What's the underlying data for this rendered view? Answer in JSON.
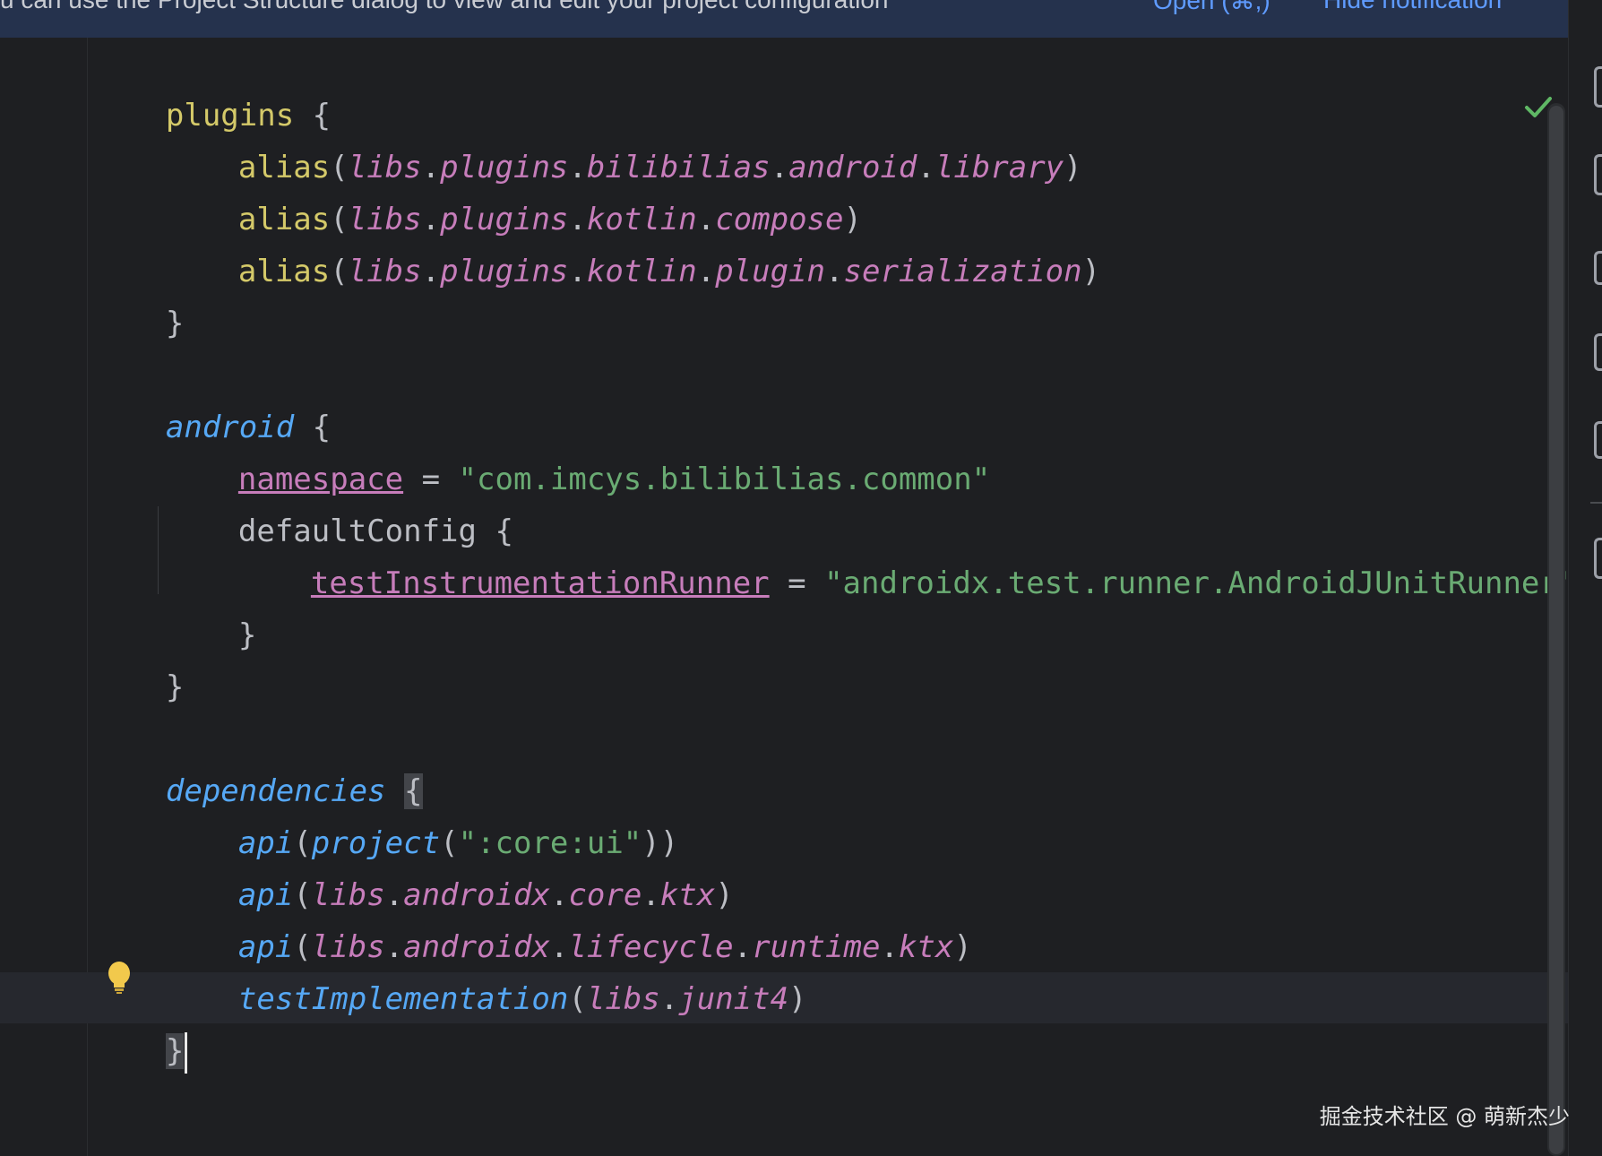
{
  "banner": {
    "message": "u can use the Project Structure dialog to view and edit your project configuration",
    "open_label": "Open (⌘;)",
    "hide_label": "Hide notification"
  },
  "code": {
    "l1": {
      "kw": "plugins",
      "brace": " {"
    },
    "l2": {
      "fn": "alias",
      "open": "(",
      "path": [
        "libs",
        "plugins",
        "bilibilias",
        "android",
        "library"
      ],
      "close": ")"
    },
    "l3": {
      "fn": "alias",
      "open": "(",
      "path": [
        "libs",
        "plugins",
        "kotlin",
        "compose"
      ],
      "close": ")"
    },
    "l4": {
      "fn": "alias",
      "open": "(",
      "path": [
        "libs",
        "plugins",
        "kotlin",
        "plugin",
        "serialization"
      ],
      "close": ")"
    },
    "l5": "}",
    "l7": {
      "kw": "android",
      "brace": " {"
    },
    "l8": {
      "prop": "namespace",
      "eq": " = ",
      "str": "\"com.imcys.bilibilias.common\""
    },
    "l9": {
      "kw": "defaultConfig",
      "brace": " {"
    },
    "l10": {
      "prop": "testInstrumentationRunner",
      "eq": " = ",
      "str": "\"androidx.test.runner.AndroidJUnitRunner\""
    },
    "l11": "}",
    "l12": "}",
    "l14": {
      "kw": "dependencies",
      "space": " ",
      "brace": "{"
    },
    "l15": {
      "fn": "api",
      "open": "(",
      "fn2": "project",
      "open2": "(",
      "str": "\":core:ui\"",
      "close": "))"
    },
    "l16": {
      "fn": "api",
      "open": "(",
      "path": [
        "libs",
        "androidx",
        "core",
        "ktx"
      ],
      "close": ")"
    },
    "l17": {
      "fn": "api",
      "open": "(",
      "path": [
        "libs",
        "androidx",
        "lifecycle",
        "runtime",
        "ktx"
      ],
      "close": ")"
    },
    "l18": {
      "fn": "testImplementation",
      "open": "(",
      "path": [
        "libs",
        "junit4"
      ],
      "close": ")"
    },
    "l19": "}"
  },
  "icons": {
    "inspection": "check-icon",
    "intention": "lightbulb-icon"
  },
  "colors": {
    "background": "#1e1f22",
    "keyword_blue": "#56a8f5",
    "function_yellow": "#d4c969",
    "lib_purple": "#c77dbb",
    "string_green": "#6aab73",
    "banner_bg": "#25324d",
    "link_blue": "#5f9bff"
  },
  "watermark": "掘金技术社区 @ 萌新杰少"
}
